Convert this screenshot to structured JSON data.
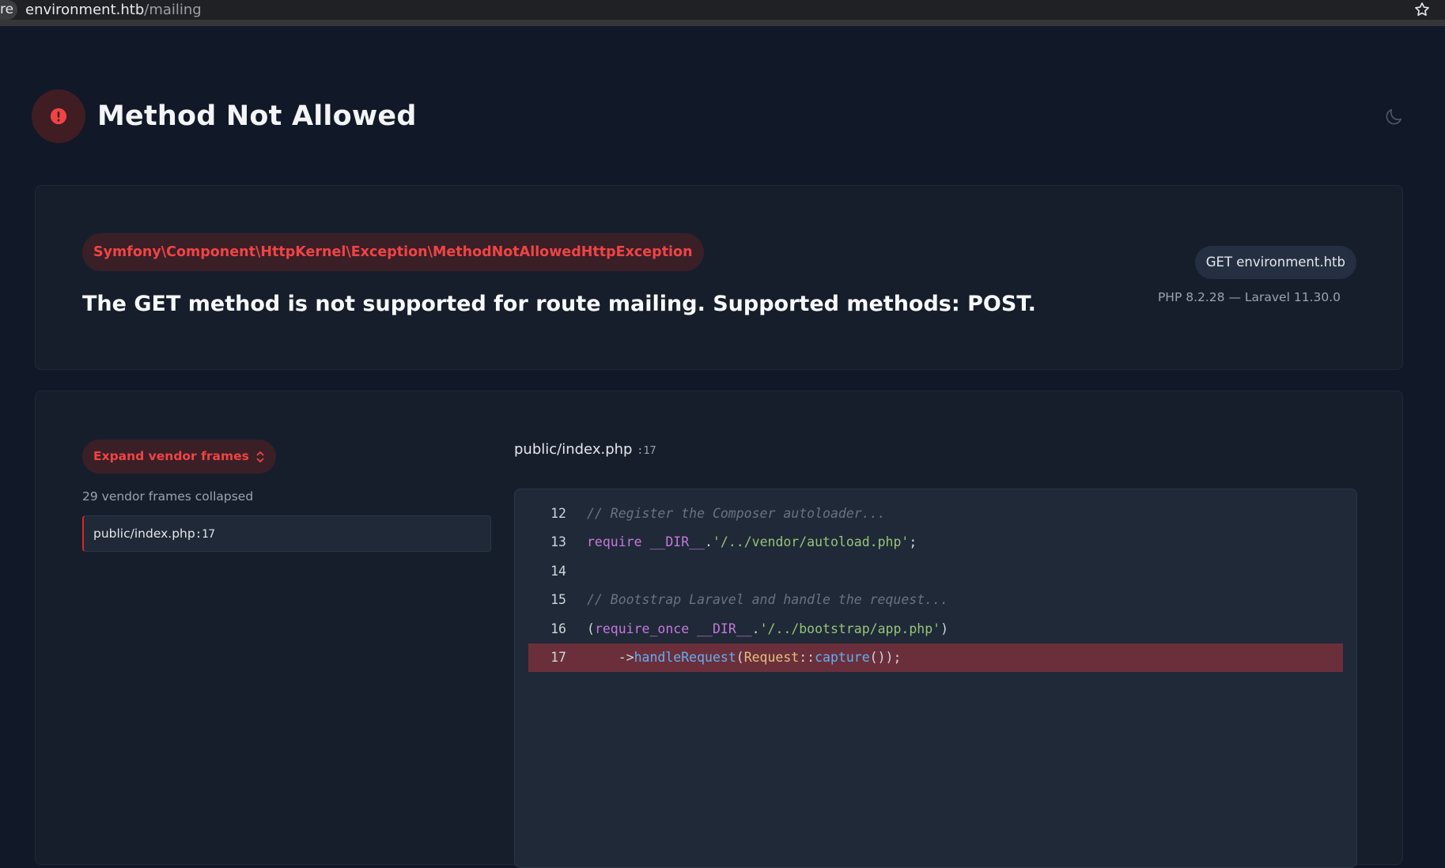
{
  "browser": {
    "tab_edge": "re",
    "url_host": "environment.htb",
    "url_path": "/mailing"
  },
  "header": {
    "title": "Method Not Allowed"
  },
  "exception": {
    "class": "Symfony\\Component\\HttpKernel\\Exception\\MethodNotAllowedHttpException",
    "message": "The GET method is not supported for route mailing. Supported methods: POST.",
    "request": "GET environment.htb",
    "versions": "PHP 8.2.28 — Laravel 11.30.0"
  },
  "trace": {
    "vendor_button_label": "Expand vendor frames",
    "collapsed_note": "29 vendor frames collapsed",
    "frame_file": "public/index.php",
    "frame_line": ":17",
    "heading_file": "public/index.php",
    "heading_line": ":17"
  },
  "code": {
    "lines": [
      {
        "num": "12",
        "text": "// Register the Composer autoloader..."
      },
      {
        "num": "13",
        "text": "require __DIR__.'/../vendor/autoload.php';"
      },
      {
        "num": "14",
        "text": ""
      },
      {
        "num": "15",
        "text": "// Bootstrap Laravel and handle the request..."
      },
      {
        "num": "16",
        "text": "(require_once __DIR__.'/../bootstrap/app.php')"
      },
      {
        "num": "17",
        "text": "    ->handleRequest(Request::capture());"
      }
    ],
    "highlight_line": "17"
  },
  "colors": {
    "accent_red": "#ef4444",
    "highlight_row": "#6b2f3c",
    "background": "#111827"
  },
  "icons": {
    "error": "exclamation-circle-icon",
    "theme": "moon-icon",
    "bookmark": "star-icon",
    "expand": "chevron-up-down-icon"
  }
}
